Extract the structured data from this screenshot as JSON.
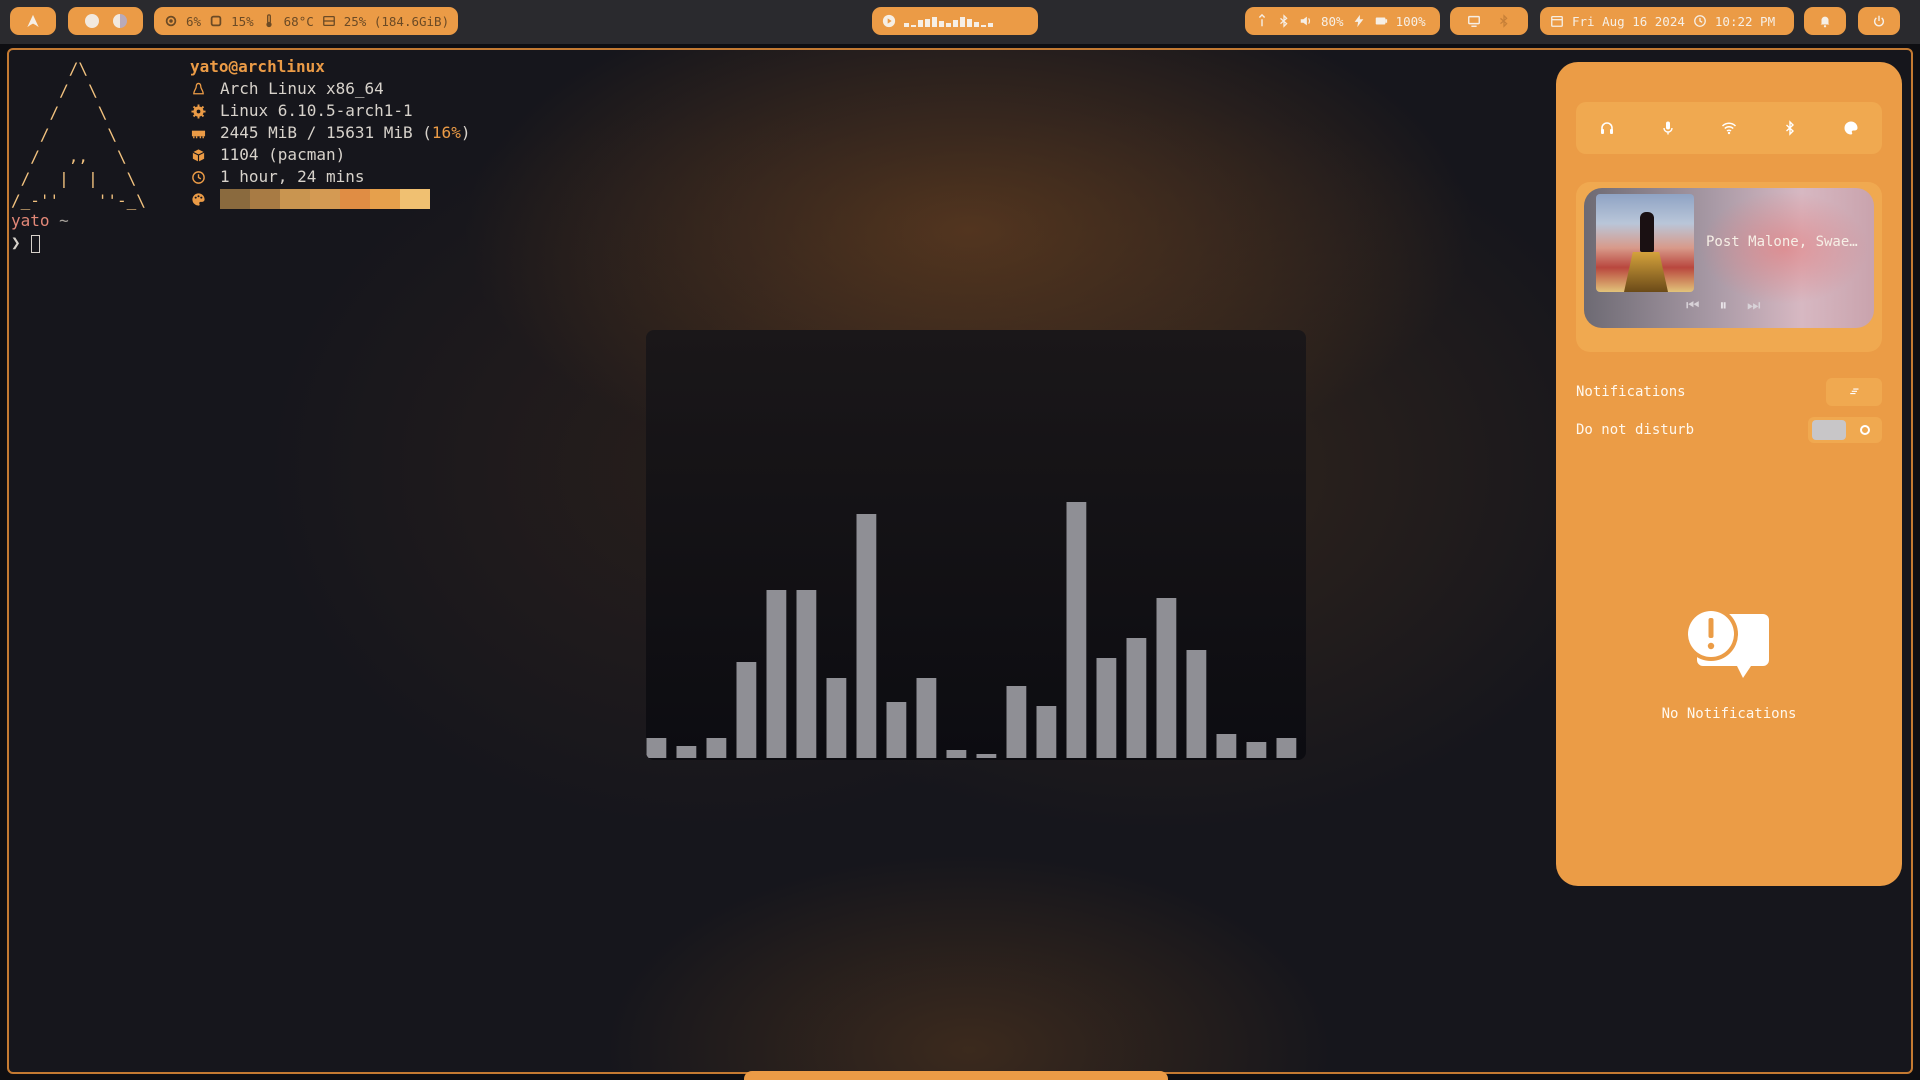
{
  "topbar": {
    "launcher_icon": "arch-logo-icon",
    "workspaces": [
      "workspace-active",
      "workspace-secondary"
    ],
    "stats": {
      "cpu": "6%",
      "mem": "15%",
      "temp": "68°C",
      "disk": "25% (184.6GiB)"
    },
    "media_player_icon": "play-circle-icon",
    "visualizer_levels": [
      0.3,
      0.2,
      0.6,
      0.7,
      0.8,
      0.5,
      0.3,
      0.6,
      0.8,
      0.7,
      0.4,
      0.2,
      0.3
    ],
    "system": {
      "network": "",
      "bluetooth": "",
      "volume": "80%",
      "power": "100%"
    },
    "date": "Fri Aug 16 2024",
    "time": "10:22 PM"
  },
  "terminal": {
    "ascii_logo": "      /\\\n     /  \\\n    /    \\\n   /      \\\n  /   ,,   \\\n /   |  |   \\\n/_-''    ''-_\\",
    "header": "yato@archlinux",
    "rows": [
      {
        "icon": "tux-icon",
        "text": "Arch Linux x86_64"
      },
      {
        "icon": "gear-icon",
        "text": "Linux 6.10.5-arch1-1"
      },
      {
        "icon": "memory-icon",
        "text": "2445 MiB / 15631 MiB (",
        "pct": "16%",
        "tail": ")"
      },
      {
        "icon": "package-icon",
        "text": "1104 (pacman)"
      },
      {
        "icon": "clock-icon",
        "text": "1 hour, 24 mins"
      }
    ],
    "palette": [
      "#8a6a3e",
      "#a87b44",
      "#c99550",
      "#d49a53",
      "#e08d44",
      "#e6a04c",
      "#f0c071"
    ],
    "prompt_user": "yato",
    "prompt_dir": "~",
    "prompt_arrow": "❯"
  },
  "visualizer": {
    "levels": [
      0.05,
      0.03,
      0.05,
      0.24,
      0.42,
      0.42,
      0.2,
      0.61,
      0.14,
      0.2,
      0.02,
      0.01,
      0.18,
      0.13,
      0.64,
      0.25,
      0.3,
      0.4,
      0.27,
      0.06,
      0.04,
      0.05
    ],
    "bar_color": "#8f8f95"
  },
  "panel": {
    "quick_settings": [
      "headphones-icon",
      "microphone-icon",
      "wifi-icon",
      "bluetooth-icon",
      "palette-icon"
    ],
    "media": {
      "track": "Post Malone, Swae Lee - Sunflower",
      "prev": "⏮",
      "play_pause": "⏸",
      "next": "⏭"
    },
    "notifications_label": "Notifications",
    "clear_icon": "clear-all-icon",
    "dnd_label": "Do not disturb",
    "empty_text": "No Notifications"
  },
  "colors": {
    "accent": "#eb9b46",
    "background": "#16161c"
  }
}
